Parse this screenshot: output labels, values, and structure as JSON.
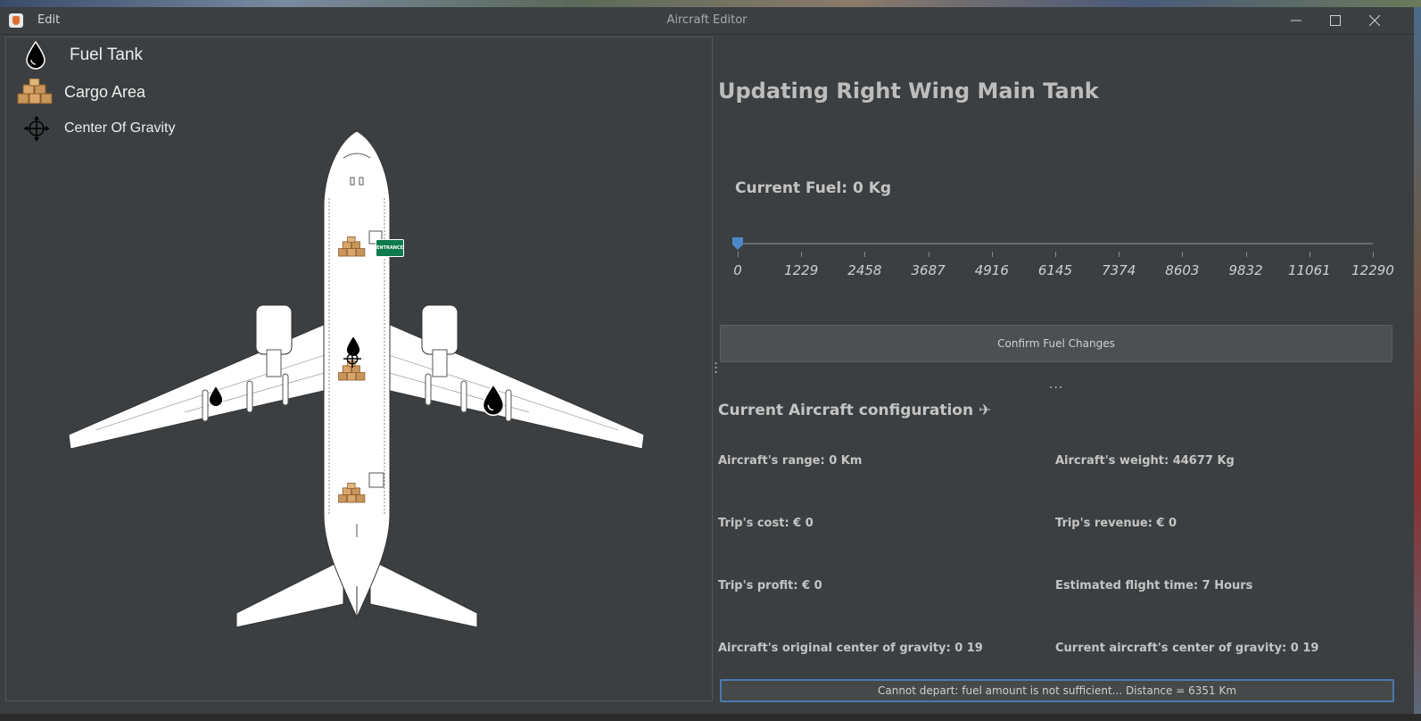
{
  "window": {
    "menu_edit": "Edit",
    "title": "Aircraft Editor"
  },
  "legend": {
    "fuel_tank": "Fuel Tank",
    "cargo_area": "Cargo Area",
    "center_of_gravity": "Center Of Gravity"
  },
  "diagram": {
    "entrance_label": "ENTRANCE"
  },
  "editor": {
    "updating_title": "Updating Right Wing Main Tank",
    "current_fuel": "Current Fuel: 0 Kg",
    "slider": {
      "value": 0,
      "min": 0,
      "max": 12290,
      "ticks": [
        "0",
        "1229",
        "2458",
        "3687",
        "4916",
        "6145",
        "7374",
        "8603",
        "9832",
        "11061",
        "12290"
      ]
    },
    "confirm_button": "Confirm Fuel Changes",
    "more": "..."
  },
  "config": {
    "title": "Current Aircraft configuration ✈",
    "range": "Aircraft's range: 0 Km",
    "weight": "Aircraft's weight: 44677 Kg",
    "cost": "Trip's cost: € 0",
    "revenue": "Trip's revenue: € 0",
    "profit": "Trip's profit: € 0",
    "flight_time": "Estimated flight time: 7 Hours",
    "original_cg": "Aircraft's original center of gravity: 0 19",
    "current_cg": "Current aircraft's center of gravity: 0 19"
  },
  "status": "Cannot depart: fuel amount is not sufficient... Distance = 6351 Km",
  "colors": {
    "background": "#3c3f41",
    "accent": "#4a7ab0",
    "entrance_green": "#0e7a4e"
  }
}
